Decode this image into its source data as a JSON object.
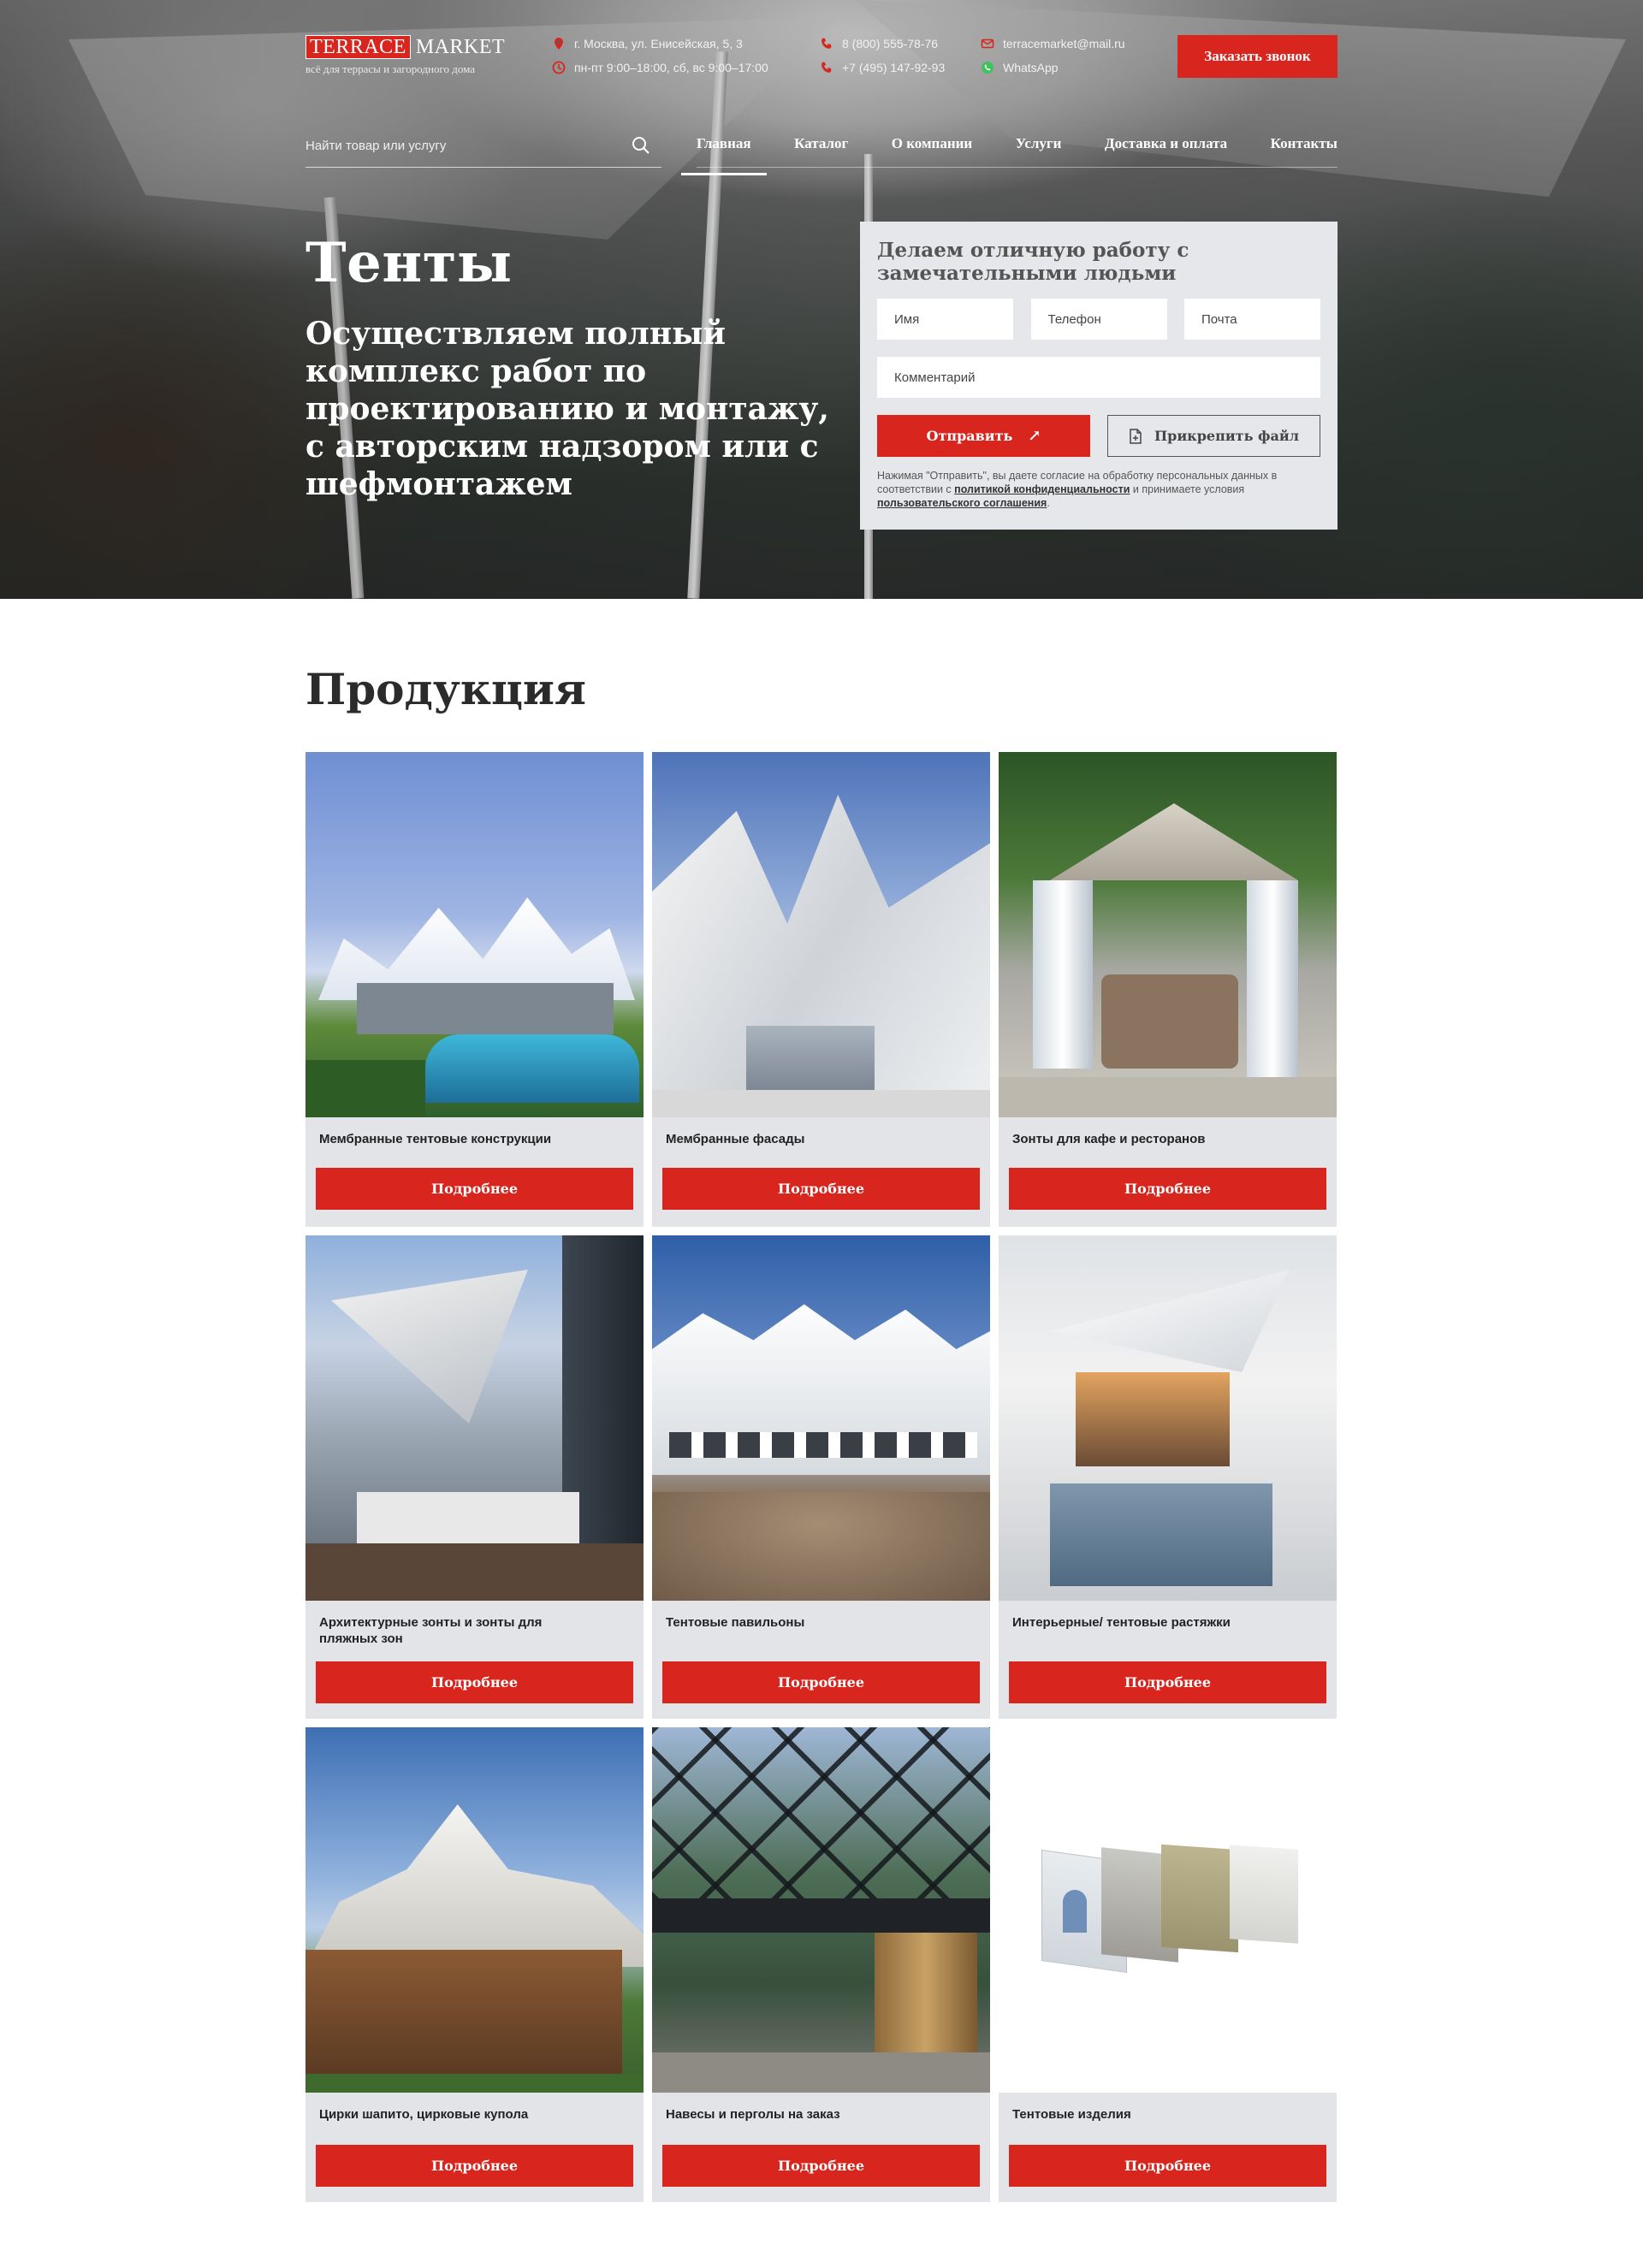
{
  "brand": {
    "logo_word1": "TERRACE",
    "logo_word2": "MARKET",
    "tagline": "всё для террасы и загородного дома",
    "accent": "#d8261f"
  },
  "header": {
    "address": "г. Москва, ул. Енисейская, 5, 3",
    "hours": "пн-пт 9:00–18:00, сб, вс 9:00–17:00",
    "phone1": "8 (800) 555-78-76",
    "phone2": "+7 (495) 147-92-93",
    "email": "terracemarket@mail.ru",
    "whatsapp": "WhatsApp",
    "call_button": "Заказать звонок",
    "search_placeholder": "Найти товар или услугу",
    "icons": {
      "location": "location-pin-icon",
      "clock": "clock-icon",
      "phone": "phone-icon",
      "mail": "mail-icon",
      "whatsapp": "whatsapp-icon",
      "search": "search-icon"
    }
  },
  "nav": {
    "items": [
      {
        "label": "Главная",
        "active": true
      },
      {
        "label": "Каталог"
      },
      {
        "label": "О компании"
      },
      {
        "label": "Услуги"
      },
      {
        "label": "Доставка и оплата"
      },
      {
        "label": "Контакты"
      }
    ]
  },
  "hero": {
    "title": "Тенты",
    "subtitle": "Осуществляем полный комплекс работ по проектированию и монтажу, с авторским надзором или с шефмонтажем"
  },
  "form": {
    "title": "Делаем отличную работу с замечательными людьми",
    "name_placeholder": "Имя",
    "phone_placeholder": "Телефон",
    "email_placeholder": "Почта",
    "comment_placeholder": "Комментарий",
    "send_label": "Отправить",
    "attach_label": "Прикрепить файл",
    "consent_prefix": "Нажимая \"Отправить\", вы даете согласие на обработку персональных данных в соответствии с",
    "consent_link1": "политикой конфиденциальности",
    "consent_middle": "и принимаете условия",
    "consent_link2": "пользовательского соглашения",
    "consent_end": "."
  },
  "products": {
    "title": "Продукция",
    "button_label": "Подробнее",
    "items": [
      {
        "name": "Мембранные тентовые конструкции"
      },
      {
        "name": "Мембранные фасады"
      },
      {
        "name": "Зонты для кафе и ресторанов"
      },
      {
        "name": "Архитектурные зонты и зонты для пляжных зон"
      },
      {
        "name": "Тентовые павильоны"
      },
      {
        "name": "Интерьерные/ тентовые растяжки"
      },
      {
        "name": "Цирки шапито, цирковые купола"
      },
      {
        "name": "Навесы и перголы на заказ"
      },
      {
        "name": "Тентовые изделия"
      }
    ]
  }
}
